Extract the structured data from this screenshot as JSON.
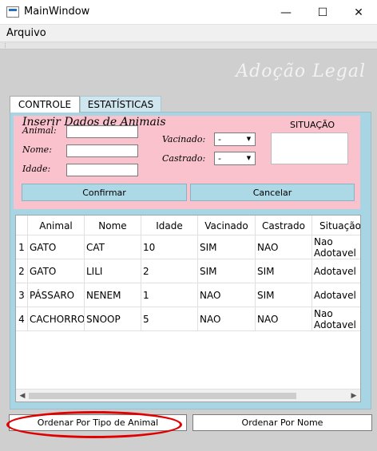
{
  "window": {
    "title": "MainWindow",
    "minimize_glyph": "—",
    "maximize_glyph": "☐",
    "close_glyph": "✕"
  },
  "menu": {
    "items": [
      "Arquivo"
    ]
  },
  "brand": "Adoção Legal",
  "tabs": [
    {
      "label": "CONTROLE",
      "active": true
    },
    {
      "label": "ESTATÍSTICAS",
      "active": false
    }
  ],
  "form": {
    "title": "Inserir Dados de Animais",
    "animal_label": "Animal:",
    "nome_label": "Nome:",
    "idade_label": "Idade:",
    "animal_value": "",
    "nome_value": "",
    "idade_value": "",
    "vacinado_label": "Vacinado:",
    "castrado_label": "Castrado:",
    "vacinado_value": "-",
    "castrado_value": "-",
    "situacao_label": "SITUAÇÃO",
    "situacao_value": "",
    "confirm_label": "Confirmar",
    "cancel_label": "Cancelar"
  },
  "table": {
    "columns": [
      "Animal",
      "Nome",
      "Idade",
      "Vacinado",
      "Castrado",
      "Situação"
    ],
    "rows": [
      {
        "num": "1",
        "cells": [
          "GATO",
          "CAT",
          "10",
          "SIM",
          "NAO",
          "Nao\nAdotavel"
        ]
      },
      {
        "num": "2",
        "cells": [
          "GATO",
          "LILI",
          "2",
          "SIM",
          "SIM",
          "Adotavel"
        ]
      },
      {
        "num": "3",
        "cells": [
          "PÁSSARO",
          "NENEM",
          "1",
          "NAO",
          "SIM",
          "Adotavel"
        ]
      },
      {
        "num": "4",
        "cells": [
          "CACHORRO",
          "SNOOP",
          "5",
          "NAO",
          "NAO",
          "Nao\nAdotavel"
        ]
      }
    ]
  },
  "bottom": {
    "sort_type_label": "Ordenar Por Tipo de Animal",
    "sort_name_label": "Ordenar Por Nome"
  },
  "colors": {
    "form_bg": "#fac2cc",
    "panel_bg": "#a7d5e3",
    "button_bg": "#add8e6",
    "highlight_oval": "#e00000"
  }
}
